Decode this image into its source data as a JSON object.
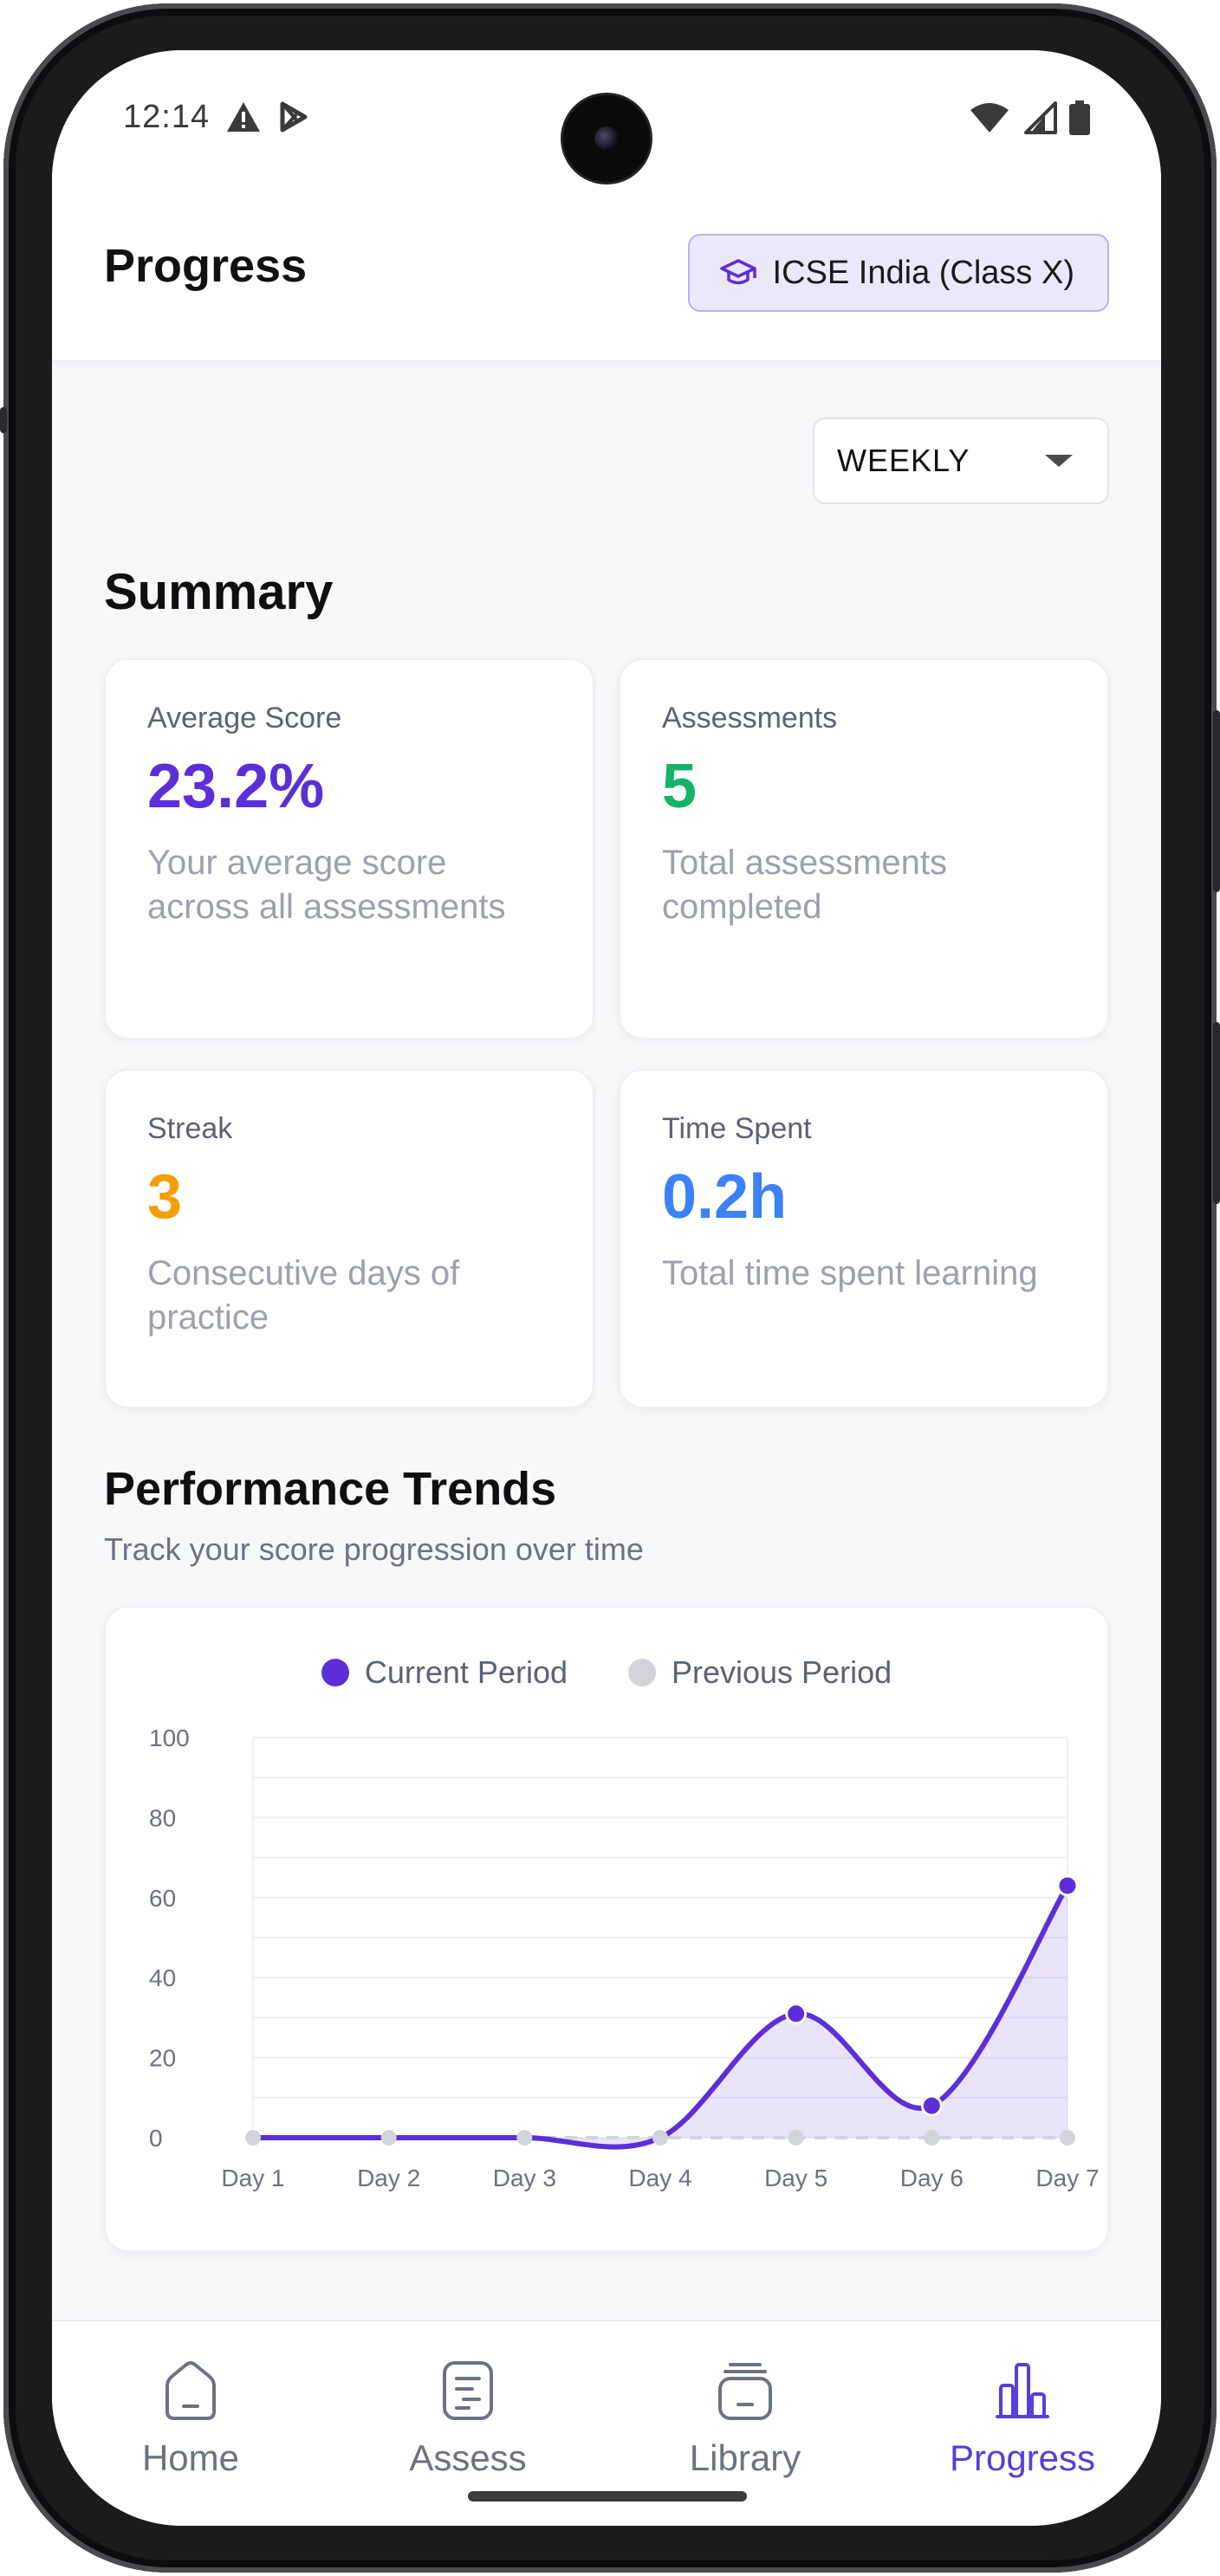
{
  "status_bar": {
    "time": "12:14"
  },
  "header": {
    "title": "Progress",
    "board_chip": "ICSE India (Class X)"
  },
  "period_select": {
    "value": "WEEKLY"
  },
  "summary": {
    "title": "Summary",
    "cards": [
      {
        "label": "Average Score",
        "value": "23.2%",
        "description": "Your average score across all assessments",
        "color": "#5b2fd8"
      },
      {
        "label": "Assessments",
        "value": "5",
        "description": "Total assessments completed",
        "color": "#17b26a"
      },
      {
        "label": "Streak",
        "value": "3",
        "description": "Consecutive days of practice",
        "color": "#f59e0b"
      },
      {
        "label": "Time Spent",
        "value": "0.2h",
        "description": "Total time spent learning",
        "color": "#3b82f6"
      }
    ]
  },
  "trends": {
    "title": "Performance Trends",
    "subtitle": "Track your score progression over time"
  },
  "chart_data": {
    "type": "area",
    "categories": [
      "Day 1",
      "Day 2",
      "Day 3",
      "Day 4",
      "Day 5",
      "Day 6",
      "Day 7"
    ],
    "yticks": [
      0,
      20,
      40,
      60,
      80,
      100
    ],
    "ylim": [
      0,
      100
    ],
    "grid": true,
    "legend_position": "top-center",
    "series": [
      {
        "name": "Current Period",
        "values": [
          0,
          0,
          0,
          0,
          31,
          8,
          63
        ],
        "color": "#5b2fd8"
      },
      {
        "name": "Previous Period",
        "values": [
          0,
          0,
          0,
          0,
          0,
          0,
          0
        ],
        "color": "#d1d5db"
      }
    ]
  },
  "nav": {
    "items": [
      {
        "label": "Home",
        "icon": "home-icon",
        "active": false
      },
      {
        "label": "Assess",
        "icon": "assess-icon",
        "active": false
      },
      {
        "label": "Library",
        "icon": "library-icon",
        "active": false
      },
      {
        "label": "Progress",
        "icon": "progress-icon",
        "active": true
      }
    ]
  }
}
